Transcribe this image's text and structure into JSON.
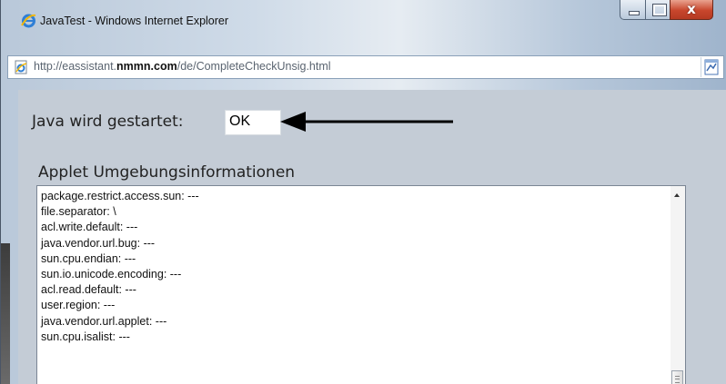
{
  "window": {
    "title": "JavaTest - Windows Internet Explorer",
    "close_glyph": "x",
    "icons": [
      "internet-explorer-icon",
      "minimize-icon",
      "maximize-icon",
      "close-icon"
    ]
  },
  "address_bar": {
    "url_prefix": "http://eassistant.",
    "url_domain": "nmmn.com",
    "url_path": "/de/CompleteCheckUnsig.html",
    "icons": [
      "page-icon",
      "compatibility-view-icon"
    ]
  },
  "page": {
    "status_label": "Java wird gestartet:",
    "status_value": "OK",
    "section_title": "Applet Umgebungsinformationen",
    "info_lines": [
      "package.restrict.access.sun: ---",
      "file.separator: \\",
      "acl.write.default: ---",
      "java.vendor.url.bug: ---",
      "sun.cpu.endian: ---",
      "sun.io.unicode.encoding: ---",
      "acl.read.default: ---",
      "user.region: ---",
      "java.vendor.url.applet: ---",
      "sun.cpu.isalist: ---"
    ]
  },
  "colors": {
    "close_button": "#c8462c",
    "client_background": "#c4ccd6",
    "arrow": "#000000"
  }
}
